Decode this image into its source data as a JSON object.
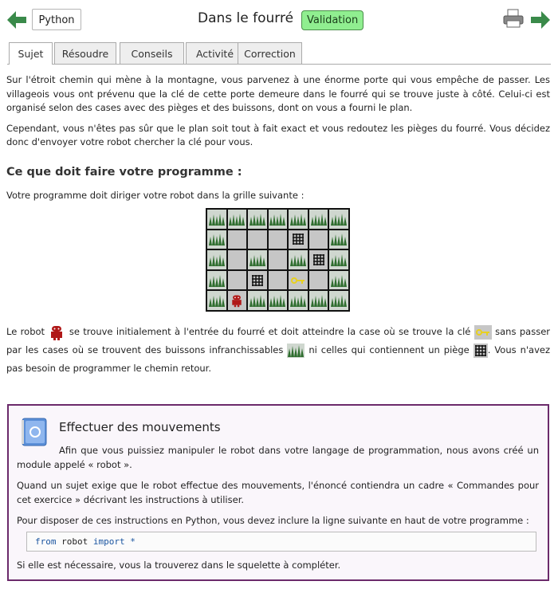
{
  "header": {
    "language_button": "Python",
    "title": "Dans le fourré",
    "validation_badge": "Validation"
  },
  "tabs": [
    {
      "label": "Sujet",
      "active": true
    },
    {
      "label": "Résoudre",
      "active": false
    },
    {
      "label": "Conseils",
      "active": false
    },
    {
      "label": "Activité",
      "active": false
    },
    {
      "label": "Correction",
      "active": false
    }
  ],
  "intro": {
    "p1": "Sur l'étroit chemin qui mène à la montagne, vous parvenez à une énorme porte qui vous empêche de passer. Les villageois vous ont prévenu que la clé de cette porte demeure dans le fourré qui se trouve juste à côté. Celui-ci est organisé selon des cases avec des pièges et des buissons, dont on vous a fourni le plan.",
    "p2": "Cependant, vous n'êtes pas sûr que le plan soit tout à fait exact et vous redoutez les pièges du fourré. Vous décidez donc d'envoyer votre robot chercher la clé pour vous."
  },
  "section": {
    "heading": "Ce que doit faire votre programme :",
    "grid_intro": "Votre programme doit diriger votre robot dans la grille suivante :",
    "desc_parts": [
      "Le robot ",
      " se trouve initialement à l'entrée du fourré et doit atteindre la case où se trouve la clé ",
      " sans passer par les cases où se trouvent des buissons infranchissables ",
      " ni celles qui contiennent un piège ",
      ". Vous n'avez pas besoin de programmer le chemin retour."
    ]
  },
  "grid": {
    "rows": [
      [
        "bush",
        "bush",
        "bush",
        "bush",
        "bush",
        "bush",
        "bush"
      ],
      [
        "bush",
        "empty",
        "empty",
        "empty",
        "trap",
        "empty",
        "bush"
      ],
      [
        "bush",
        "empty",
        "bush",
        "empty",
        "bush",
        "trap",
        "bush"
      ],
      [
        "bush",
        "empty",
        "trap",
        "empty",
        "key",
        "empty",
        "bush"
      ],
      [
        "bush",
        "robot",
        "bush",
        "bush",
        "bush",
        "bush",
        "bush"
      ]
    ]
  },
  "moves_box": {
    "title": "Effectuer des mouvements",
    "p1": "Afin que vous puissiez manipuler le robot dans votre langage de programmation, nous avons créé un module appelé « robot ».",
    "p2": "Quand un sujet exige que le robot effectue des mouvements, l'énoncé contiendra un cadre « Commandes pour cet exercice » décrivant les instructions à utiliser.",
    "p3": "Pour disposer de ces instructions en Python, vous devez inclure la ligne suivante en haut de votre programme :",
    "code_kw1": "from",
    "code_mod": "robot",
    "code_kw2": "import",
    "code_star": "*",
    "p4": "Si elle est nécessaire, vous la trouverez dans le squelette à compléter."
  },
  "colors": {
    "accent_arrow": "#3a8a4a",
    "validation_bg": "#90ee90",
    "box_border": "#6b2a6b",
    "robot": "#b01818",
    "key": "#e8d020"
  }
}
